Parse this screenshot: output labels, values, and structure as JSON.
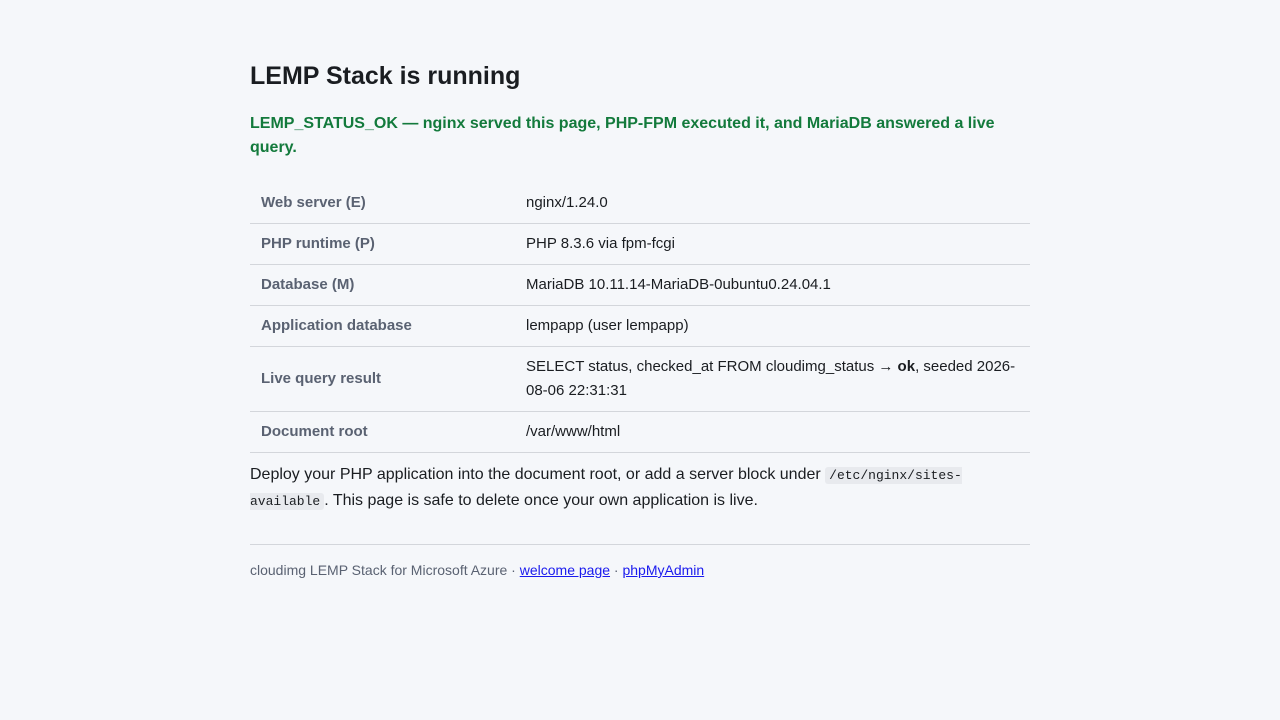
{
  "title": "LEMP Stack is running",
  "status_message": "LEMP_STATUS_OK — nginx served this page, PHP-FPM executed it, and MariaDB answered a live query.",
  "info_table": {
    "rows": [
      {
        "label": "Web server (E)",
        "value": "nginx/1.24.0"
      },
      {
        "label": "PHP runtime (P)",
        "value": "PHP 8.3.6 via fpm-fcgi"
      },
      {
        "label": "Database (M)",
        "value": "MariaDB 10.11.14-MariaDB-0ubuntu0.24.04.1"
      },
      {
        "label": "Application database",
        "value": "lempapp (user lempapp)"
      },
      {
        "label": "Live query result",
        "value_prefix": "SELECT status, checked_at FROM cloudimg_status → ",
        "value_bold": "ok",
        "value_suffix": ", seeded 2026-08-06 22:31:31"
      },
      {
        "label": "Document root",
        "value": "/var/www/html"
      }
    ]
  },
  "note": {
    "text_before": "Deploy your PHP application into the document root, or add a server block under ",
    "code": "/etc/nginx/sites-available",
    "text_after": ". This page is safe to delete once your own application is live."
  },
  "footer": {
    "text": "cloudimg LEMP Stack for Microsoft Azure · ",
    "separator": " · ",
    "welcome_link": "welcome page",
    "phpmyadmin_link": "phpMyAdmin"
  },
  "colors": {
    "background": "#f5f7fa",
    "status_green": "#137a3c",
    "label_gray": "#5a6272",
    "link_blue": "#1a1aee",
    "border": "#d3d6db"
  }
}
